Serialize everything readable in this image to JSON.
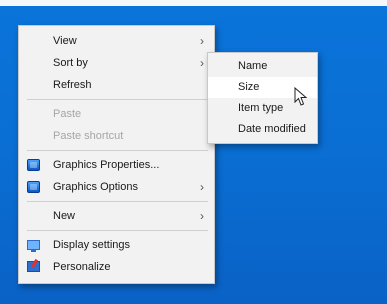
{
  "main_menu": {
    "items": [
      {
        "label": "View"
      },
      {
        "label": "Sort by"
      },
      {
        "label": "Refresh"
      },
      {
        "label": "Paste"
      },
      {
        "label": "Paste shortcut"
      },
      {
        "label": "Graphics Properties..."
      },
      {
        "label": "Graphics Options"
      },
      {
        "label": "New"
      },
      {
        "label": "Display settings"
      },
      {
        "label": "Personalize"
      }
    ]
  },
  "sort_submenu": {
    "items": [
      {
        "label": "Name"
      },
      {
        "label": "Size"
      },
      {
        "label": "Item type"
      },
      {
        "label": "Date modified"
      }
    ]
  },
  "colors": {
    "desktop_background": "#0a6fd4",
    "menu_background": "#f2f2f2",
    "disabled_text": "#a6a6a6"
  }
}
